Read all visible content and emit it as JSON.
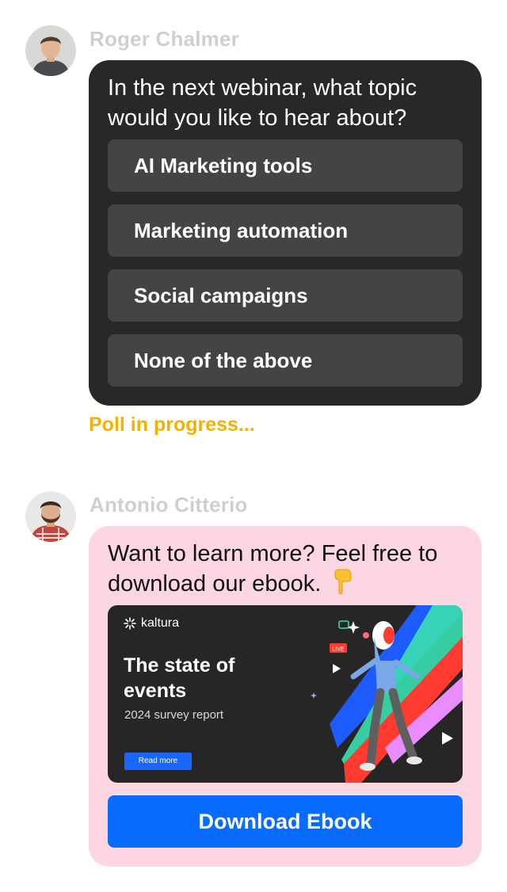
{
  "messages": [
    {
      "sender": "Roger Chalmer",
      "avatar_icon": "man-portrait-avatar",
      "poll": {
        "question": "In the next webinar, what topic would you like to hear about?",
        "options": [
          "AI Marketing tools",
          "Marketing automation",
          "Social campaigns",
          "None of the above"
        ]
      },
      "status": "Poll in progress..."
    },
    {
      "sender": "Antonio Citterio",
      "avatar_icon": "bearded-man-portrait-avatar",
      "text": "Want to learn more? Feel free to download our ebook.",
      "emoji_icon": "pointing-down-hand-icon",
      "banner": {
        "brand": "kaltura",
        "title": "The state of events",
        "subtitle": "2024 survey report",
        "cta": "Read more",
        "live_badge": "LIVE"
      },
      "button": "Download Ebook"
    }
  ],
  "colors": {
    "poll_bubble": "#282828",
    "poll_option": "#444444",
    "status": "#f6b100",
    "ebook_bubble": "#fcd6e0",
    "primary_button": "#0a6cff",
    "sender_name": "#cfcfcf"
  }
}
